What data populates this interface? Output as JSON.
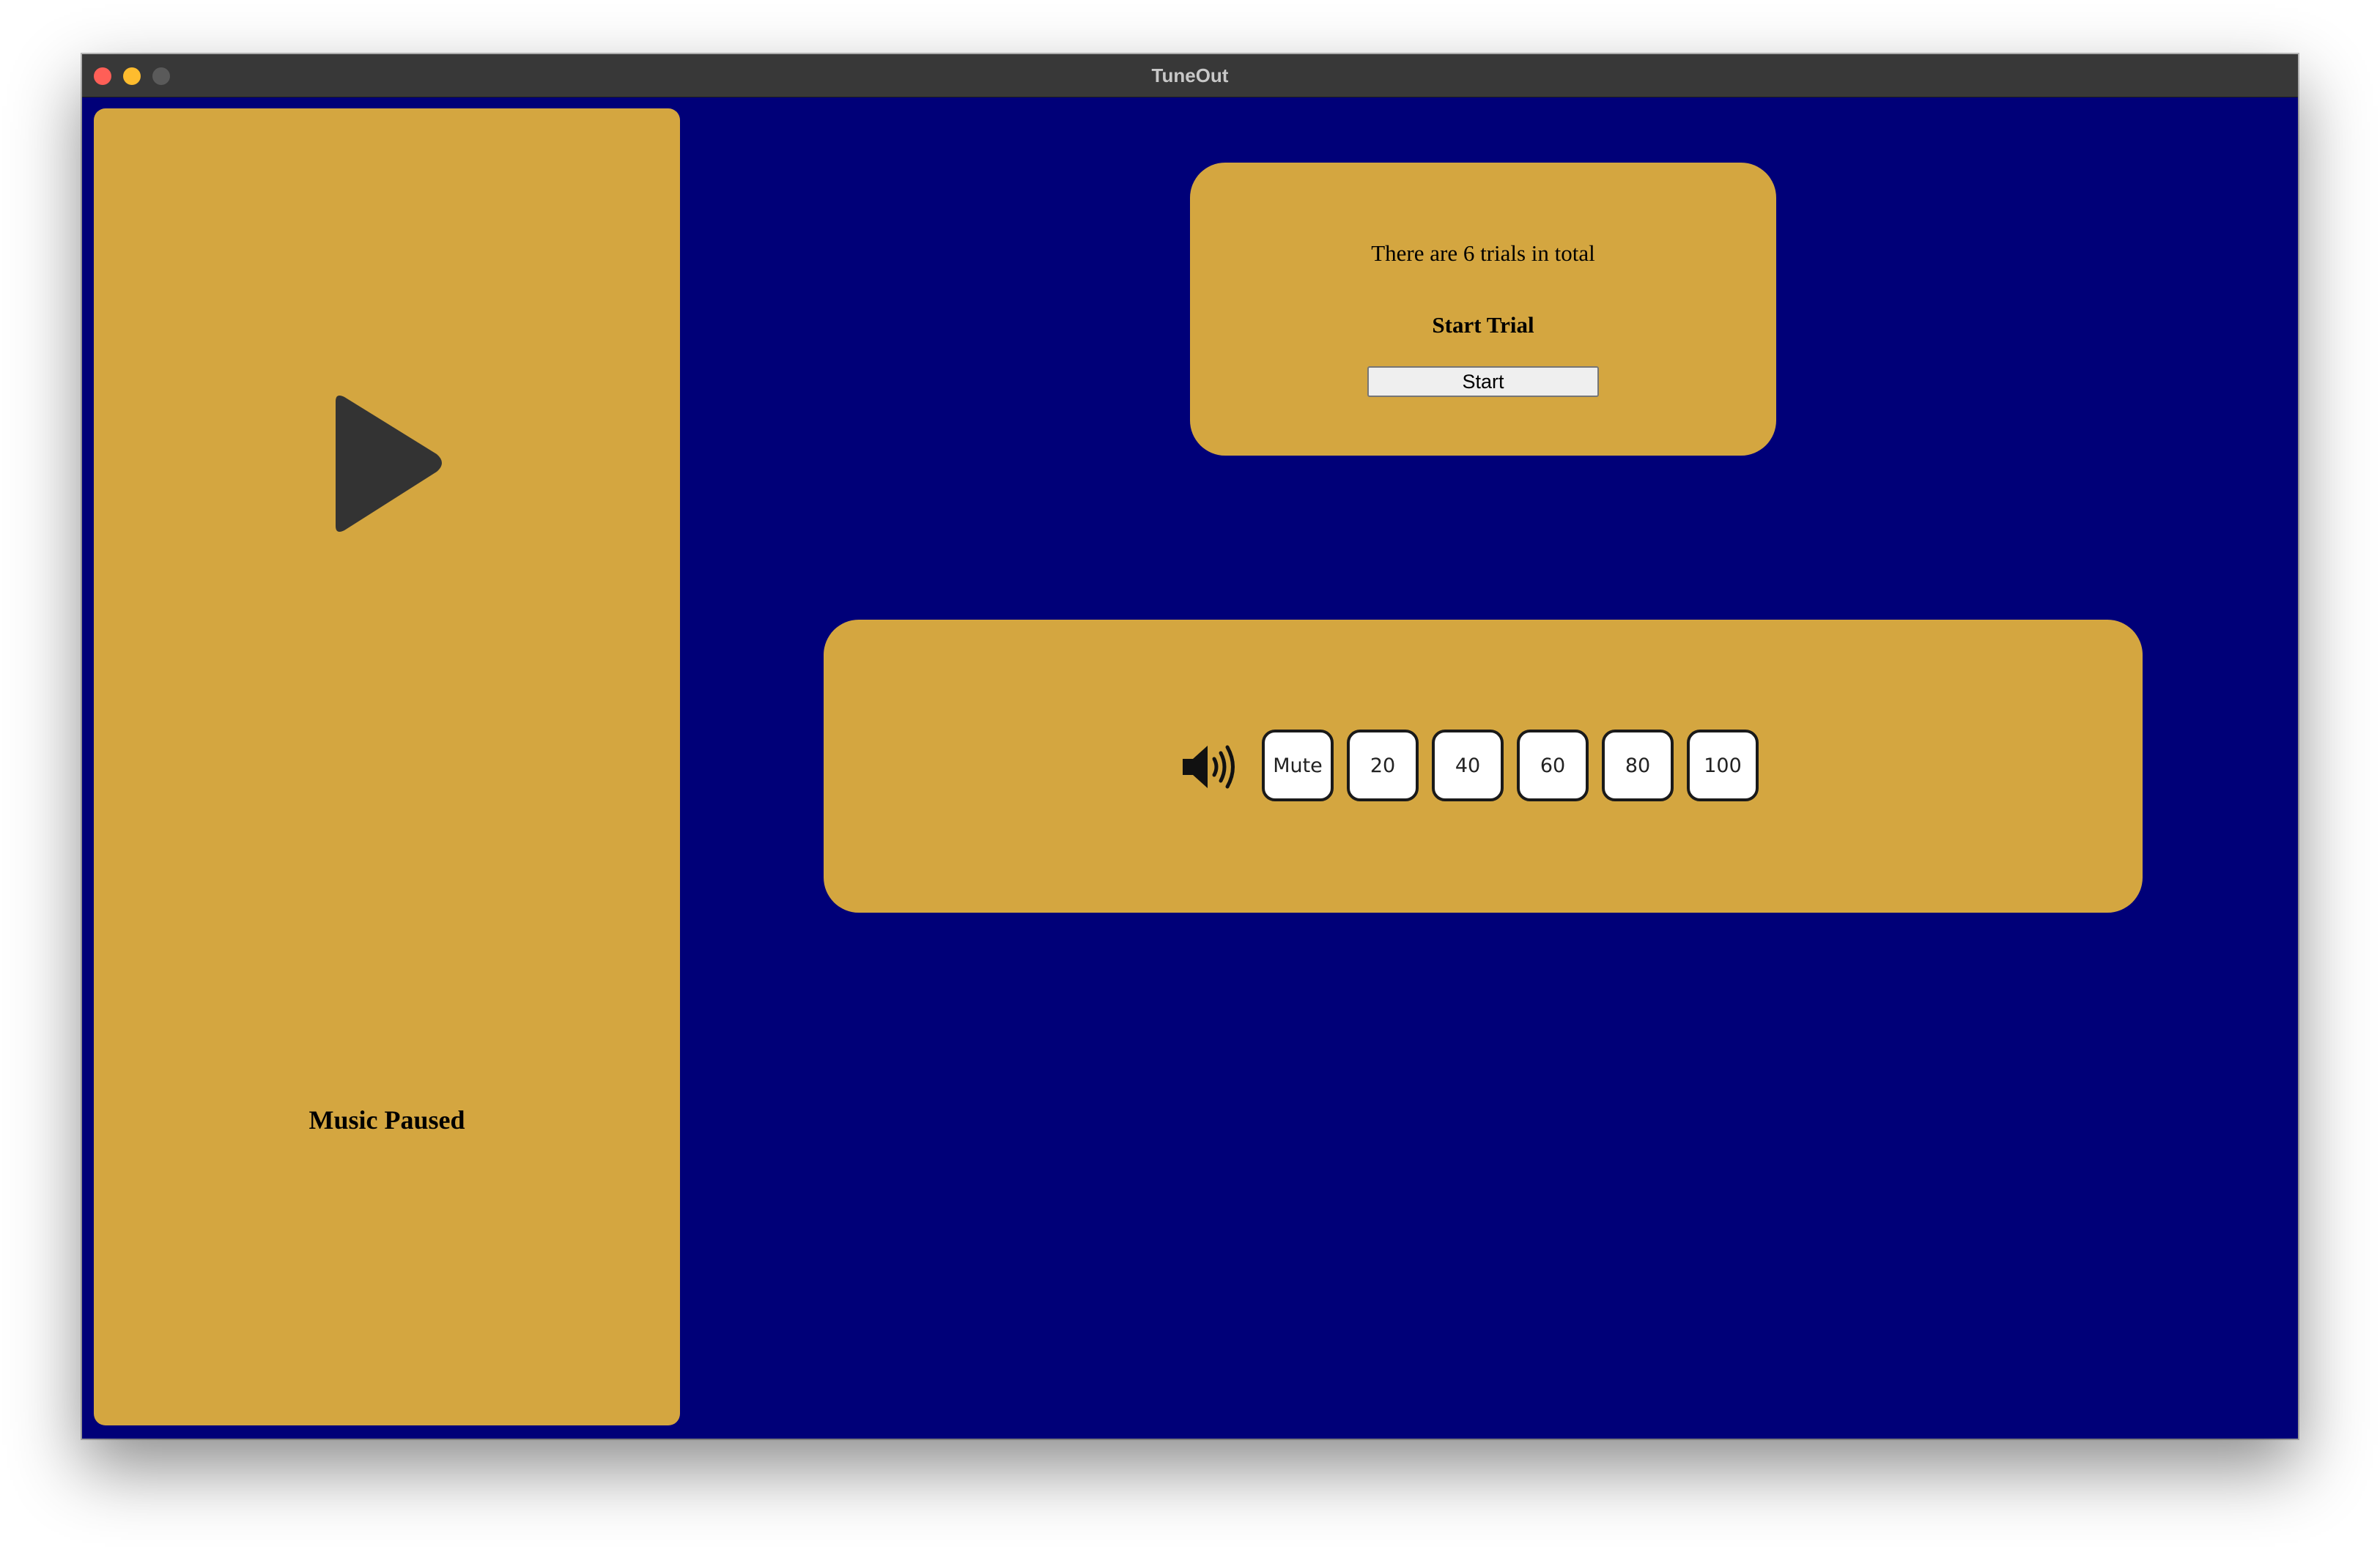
{
  "window": {
    "title": "TuneOut",
    "background_color": "#000078",
    "titlebar_text_color": "#c8c8c8",
    "traffic_lights": {
      "close_color": "#ff5f57",
      "minimize_color": "#febc2e",
      "zoom_color": "#5a5a5a"
    }
  },
  "theme": {
    "panel_color": "#d4a640",
    "icon_color": "#333333"
  },
  "player": {
    "play_icon": "play-icon",
    "status": "Music Paused"
  },
  "trial": {
    "info": "There are 6 trials in total",
    "heading": "Start Trial",
    "start_label": "Start"
  },
  "volume": {
    "icon": "speaker-volume-icon",
    "levels": [
      "Mute",
      "20",
      "40",
      "60",
      "80",
      "100"
    ]
  }
}
